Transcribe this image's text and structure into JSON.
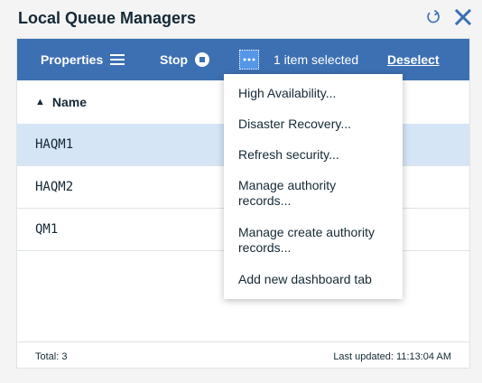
{
  "window": {
    "title": "Local Queue Managers"
  },
  "toolbar": {
    "properties_label": "Properties",
    "stop_label": "Stop",
    "more_label": "•••",
    "selection_text": "1 item selected",
    "deselect_label": "Deselect"
  },
  "table": {
    "sort_indicator": "▲",
    "column_name": "Name",
    "rows": [
      "HAQM1",
      "HAQM2",
      "QM1"
    ]
  },
  "footer": {
    "total": "Total: 3",
    "last_updated": "Last updated: 11:13:04 AM"
  },
  "menu": {
    "items": [
      "High Availability...",
      "Disaster Recovery...",
      "Refresh security...",
      "Manage authority records...",
      "Manage create authority records...",
      "Add new dashboard tab"
    ]
  },
  "colors": {
    "toolbar": "#3d70b2",
    "selected_row": "#d5e5f5",
    "accent": "#5596e6"
  }
}
